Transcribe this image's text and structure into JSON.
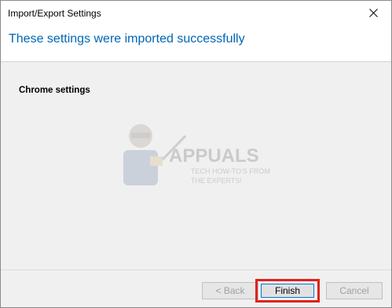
{
  "window": {
    "title": "Import/Export Settings"
  },
  "header": {
    "message": "These settings were imported successfully"
  },
  "content": {
    "section_label": "Chrome settings"
  },
  "watermark": {
    "brand": "APPUALS",
    "tagline_1": "TECH HOW-TO'S FROM",
    "tagline_2": "THE EXPERTS!"
  },
  "buttons": {
    "back": "< Back",
    "finish": "Finish",
    "cancel": "Cancel"
  },
  "colors": {
    "header_text": "#0066b4",
    "highlight_box": "#e0211c",
    "focus_border": "#0078d7"
  },
  "icons": {
    "close": "close-icon"
  }
}
